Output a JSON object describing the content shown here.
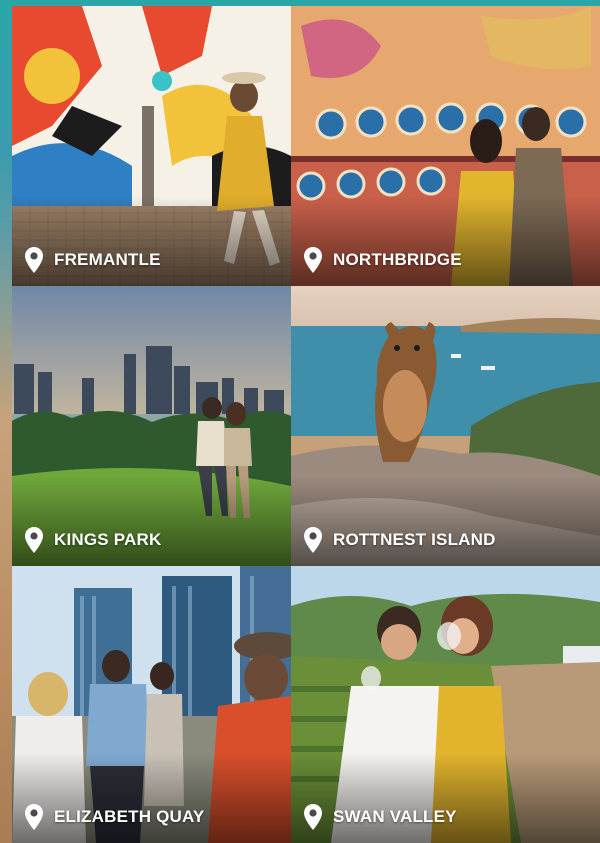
{
  "tiles": [
    {
      "id": "fremantle",
      "label": "FREMANTLE",
      "icon": "location-pin-icon"
    },
    {
      "id": "northbridge",
      "label": "NORTHBRIDGE",
      "icon": "location-pin-icon"
    },
    {
      "id": "kings-park",
      "label": "KINGS PARK",
      "icon": "location-pin-icon"
    },
    {
      "id": "rottnest-island",
      "label": "ROTTNEST ISLAND",
      "icon": "location-pin-icon"
    },
    {
      "id": "elizabeth-quay",
      "label": "ELIZABETH QUAY",
      "icon": "location-pin-icon"
    },
    {
      "id": "swan-valley",
      "label": "SWAN VALLEY",
      "icon": "location-pin-icon"
    }
  ]
}
